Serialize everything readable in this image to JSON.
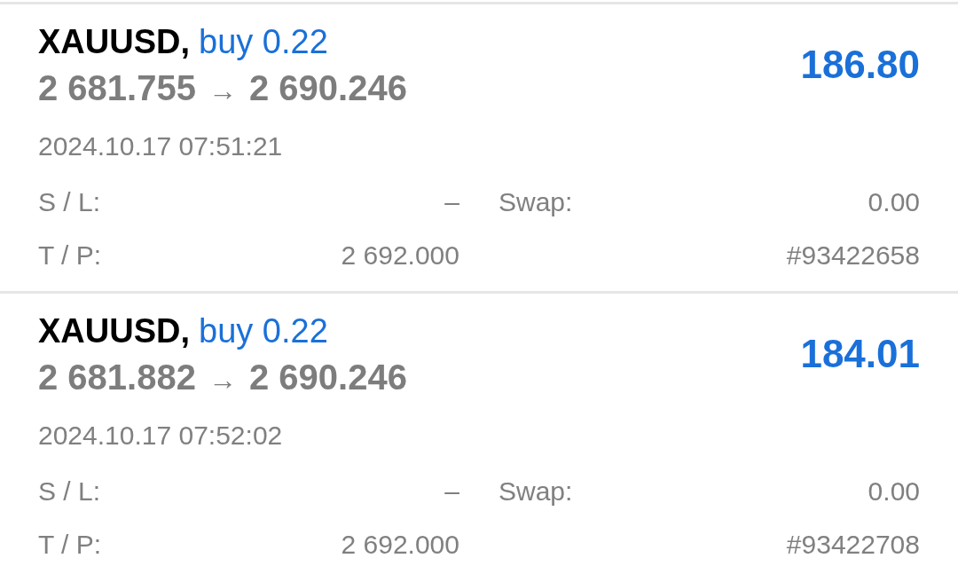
{
  "positions": [
    {
      "symbol": "XAUUSD,",
      "order": "buy 0.22",
      "prices": {
        "open": "2 681.755",
        "arrow": "→",
        "current": "2 690.246"
      },
      "profit": "186.80",
      "time": "2024.10.17 07:51:21",
      "fields": [
        {
          "label": "S / L:",
          "value": "–"
        },
        {
          "label": "Swap:",
          "value": "0.00"
        },
        {
          "label": "T / P:",
          "value": "2 692.000"
        },
        {
          "value": "#93422658"
        }
      ]
    },
    {
      "symbol": "XAUUSD,",
      "order": "buy 0.22",
      "prices": {
        "open": "2 681.882",
        "arrow": "→",
        "current": "2 690.246"
      },
      "profit": "184.01",
      "time": "2024.10.17 07:52:02",
      "fields": [
        {
          "label": "S / L:",
          "value": "–"
        },
        {
          "label": "Swap:",
          "value": "0.00"
        },
        {
          "label": "T / P:",
          "value": "2 692.000"
        },
        {
          "value": "#93422708"
        }
      ]
    }
  ]
}
